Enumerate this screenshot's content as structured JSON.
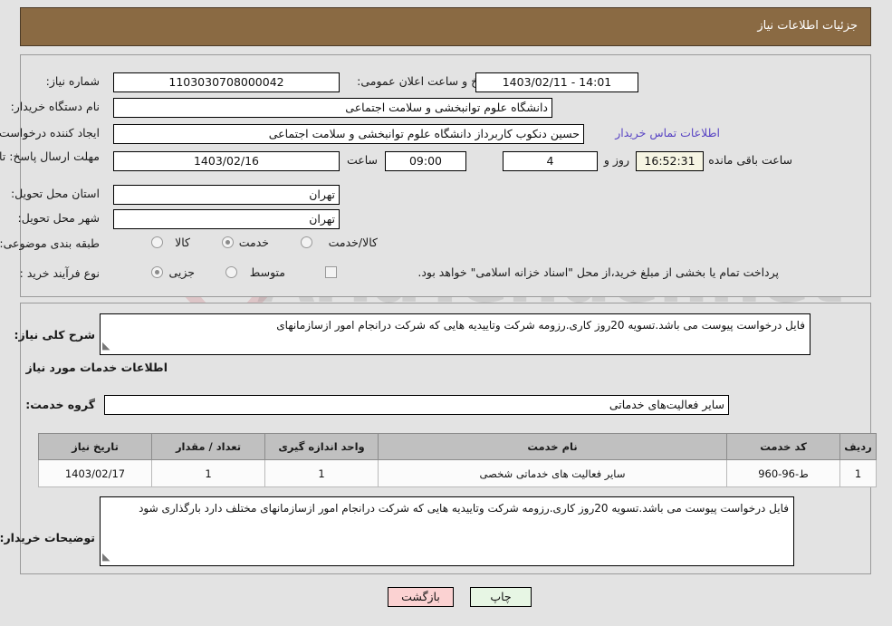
{
  "header": {
    "title": "جزئیات اطلاعات نیاز"
  },
  "watermark": {
    "text": "AriaTender.net",
    "logo": "shield-check-icon"
  },
  "form": {
    "need_number": {
      "label": "شماره نیاز:",
      "value": "1103030708000042"
    },
    "announce_datetime": {
      "label": "تاریخ و ساعت اعلان عمومی:",
      "value": "14:01 - 1403/02/11"
    },
    "buyer_org": {
      "label": "نام دستگاه خریدار:",
      "value": "دانشگاه علوم توانبخشی و سلامت اجتماعی"
    },
    "requester": {
      "label": "ایجاد کننده درخواست:",
      "value": "حسین دنکوب کاربرداز دانشگاه علوم توانبخشی و سلامت اجتماعی"
    },
    "contact_link": {
      "label": "اطلاعات تماس خریدار"
    },
    "deadline": {
      "label": "مهلت ارسال پاسخ: تا تاریخ:",
      "date": "1403/02/16",
      "time_label": "ساعت",
      "time": "09:00",
      "days": "4",
      "days_label": "روز و",
      "countdown": "16:52:31",
      "countdown_label": "ساعت باقی مانده"
    },
    "delivery_province": {
      "label": "استان محل تحویل:",
      "value": "تهران"
    },
    "delivery_city": {
      "label": "شهر محل تحویل:",
      "value": "تهران"
    },
    "subject_class": {
      "label": "طبقه بندی موضوعی:",
      "options": [
        {
          "label": "کالا",
          "selected": false
        },
        {
          "label": "خدمت",
          "selected": true
        },
        {
          "label": "کالا/خدمت",
          "selected": false
        }
      ]
    },
    "purchase_type": {
      "label": "نوع فرآیند خرید :",
      "options": [
        {
          "label": "جزیی",
          "selected": true
        },
        {
          "label": "متوسط",
          "selected": false
        }
      ],
      "checkbox_label": "پرداخت تمام یا بخشی از مبلغ خرید،از محل \"اسناد خزانه اسلامی\" خواهد بود.",
      "checkbox_checked": false
    }
  },
  "detail": {
    "general_description": {
      "label": "شرح کلی نیاز:",
      "value": "فایل درخواست پیوست می باشد.تسویه 20روز کاری.رزومه شرکت وتاییدیه هایی که شرکت درانجام امور ازسازمانهای"
    },
    "section_title": "اطلاعات خدمات مورد نیاز",
    "service_group": {
      "label": "گروه خدمت:",
      "value": "سایر فعالیت‌های خدماتی"
    },
    "table": {
      "headers": [
        "ردیف",
        "کد خدمت",
        "نام خدمت",
        "واحد اندازه گیری",
        "تعداد / مقدار",
        "تاریخ نیاز"
      ],
      "rows": [
        [
          "1",
          "ط-96-960",
          "سایر فعالیت های خدماتی شخصی",
          "1",
          "1",
          "1403/02/17"
        ]
      ]
    },
    "buyer_notes": {
      "label": "توضیحات خریدار:",
      "value": "فایل درخواست پیوست می باشد.تسویه 20روز کاری.رزومه شرکت وتاییدیه هایی که شرکت درانجام امور ازسازمانهای مختلف دارد بارگذاری شود"
    }
  },
  "footer": {
    "print_button": "چاپ",
    "back_button": "بازگشت"
  },
  "colors": {
    "header_bg": "#8a6a43",
    "page_bg": "#e3e3e3",
    "link": "#5b47c4",
    "countdown_bg": "#f6f5e3",
    "print_bg": "#e7f6e4",
    "back_bg": "#fbd2d2"
  }
}
